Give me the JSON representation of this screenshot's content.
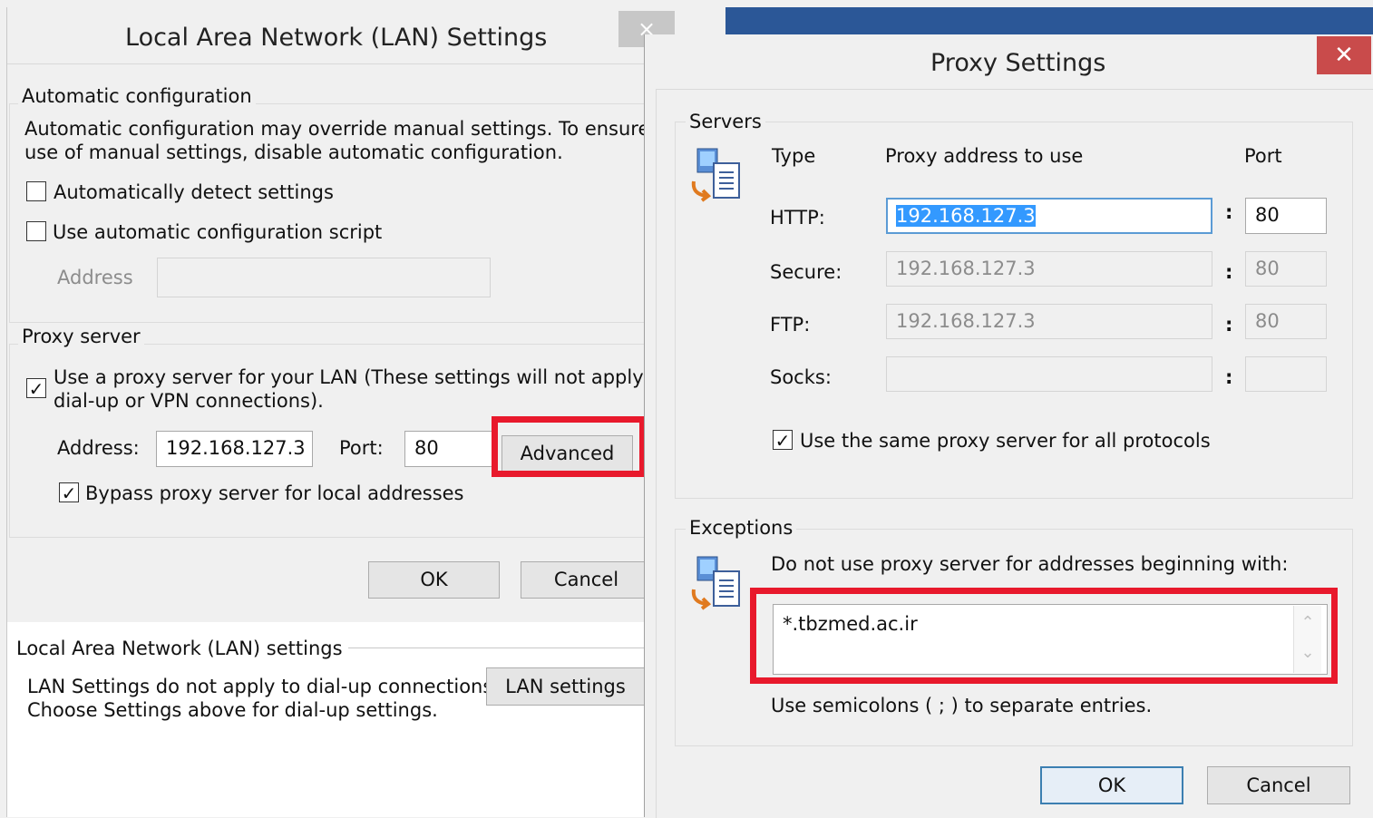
{
  "lan": {
    "title": "Local Area Network (LAN) Settings",
    "close": "×",
    "auto_group": "Automatic configuration",
    "auto_desc_1": "Automatic configuration may override manual settings.  To ensure the",
    "auto_desc_2": "use of manual settings, disable automatic configuration.",
    "auto_detect": {
      "label": "Automatically detect settings",
      "checked": false
    },
    "auto_script": {
      "label": "Use automatic configuration script",
      "checked": false
    },
    "script_address_label": "Address",
    "proxy_group": "Proxy server",
    "use_proxy_1": "Use a proxy server for your LAN (These settings will not apply to",
    "use_proxy_2": "dial-up or VPN connections).",
    "use_proxy_checked": "✓",
    "address_label": "Address:",
    "address_value": "192.168.127.3",
    "port_label": "Port:",
    "port_value": "80",
    "advanced": "Advanced",
    "bypass": "Bypass proxy server for local addresses",
    "bypass_checked": "✓",
    "ok": "OK",
    "cancel": "Cancel"
  },
  "behind": {
    "lan_group": "Local Area Network (LAN) settings",
    "lan_desc_1": "LAN Settings do not apply to dial-up connections.",
    "lan_desc_2": "Choose Settings above for dial-up settings.",
    "lan_settings": "LAN settings"
  },
  "proxy": {
    "title": "Proxy Settings",
    "close": "✕",
    "servers_group": "Servers",
    "col_type": "Type",
    "col_address": "Proxy address to use",
    "col_port": "Port",
    "rows": [
      {
        "type": "HTTP:",
        "address": "192.168.127.3",
        "port": "80"
      },
      {
        "type": "Secure:",
        "address": "192.168.127.3",
        "port": "80"
      },
      {
        "type": "FTP:",
        "address": "192.168.127.3",
        "port": "80"
      },
      {
        "type": "Socks:",
        "address": "",
        "port": ""
      }
    ],
    "colon": ":",
    "same_proxy": "Use the same proxy server for all protocols",
    "same_proxy_checked": "✓",
    "exceptions_group": "Exceptions",
    "exceptions_label": "Do not use proxy server for addresses beginning with:",
    "exceptions_value": "*.tbzmed.ac.ir",
    "exceptions_hint": "Use semicolons ( ; ) to separate entries.",
    "scroll_up": "⌃",
    "scroll_down": "⌄",
    "ok": "OK",
    "cancel": "Cancel"
  },
  "colors": {
    "highlight": "#e8192c",
    "selection": "#3399ff",
    "close_red": "#c94b4b"
  }
}
